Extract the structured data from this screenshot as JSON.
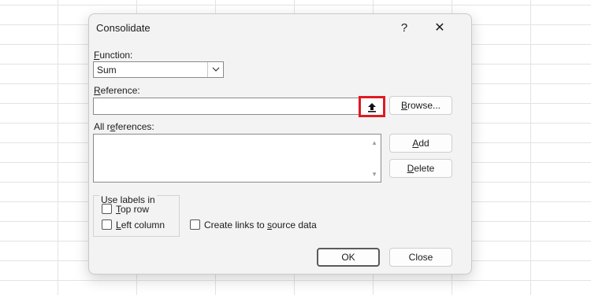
{
  "dialog": {
    "title": "Consolidate",
    "help": "?",
    "close": "✕"
  },
  "function": {
    "label_accel": "F",
    "label_rest": "unction:",
    "value": "Sum",
    "dropdown_icon": "chevron-down-icon"
  },
  "reference": {
    "label_accel": "R",
    "label_rest": "eference:",
    "value": "",
    "collapse_icon": "upload-arrow-icon",
    "collapse_glyph": "⭱",
    "browse_accel": "B",
    "browse_rest": "rowse...",
    "highlight_color": "#e01a22"
  },
  "all_references": {
    "label_pre": "All r",
    "label_accel": "e",
    "label_rest": "ferences:",
    "items": [],
    "add_accel": "A",
    "add_rest": "dd",
    "delete_accel": "D",
    "delete_rest": "elete"
  },
  "use_labels": {
    "title": "Use labels in",
    "top_row_accel": "T",
    "top_row_rest": "op row",
    "top_row_checked": false,
    "left_column_accel": "L",
    "left_column_rest": "eft column",
    "left_column_checked": false
  },
  "links": {
    "pre": "Create links to ",
    "accel": "s",
    "rest": "ource data",
    "checked": false
  },
  "buttons": {
    "ok": "OK",
    "close": "Close"
  }
}
